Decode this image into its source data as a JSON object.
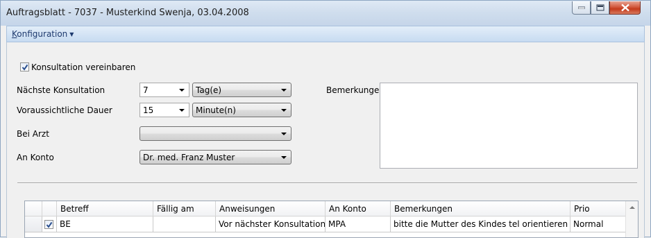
{
  "window": {
    "title": "Auftragsblatt - 7037 - Musterkind Swenja, 03.04.2008"
  },
  "menu": {
    "konfiguration_underline": "K",
    "konfiguration_rest": "onfiguration"
  },
  "form": {
    "konsultation_checkbox_label": "Konsultation vereinbaren",
    "konsultation_checked": true,
    "naechste_label": "Nächste Konsultation",
    "naechste_value": "7",
    "naechste_unit": "Tag(e)",
    "dauer_label": "Voraussichtliche Dauer",
    "dauer_value": "15",
    "dauer_unit": "Minute(n)",
    "arzt_label": "Bei Arzt",
    "arzt_value": "",
    "konto_label": "An Konto",
    "konto_value": "Dr. med. Franz Muster",
    "bemerkungen_label": "Bemerkungen",
    "bemerkungen_value": ""
  },
  "grid": {
    "columns": [
      "Betreff",
      "Fällig am",
      "Anweisungen",
      "An Konto",
      "Bemerkungen",
      "Prio"
    ],
    "rows": [
      {
        "checked": true,
        "betreff": "BE",
        "faellig": "",
        "anweisungen": "Vor nächster Konsultation",
        "konto": "MPA",
        "bemerkungen": "bitte die Mutter des Kindes tel orientieren",
        "prio": "Normal"
      }
    ]
  },
  "colors": {
    "menu_text": "#1e3a6e",
    "close_button": "#c43a1c"
  }
}
